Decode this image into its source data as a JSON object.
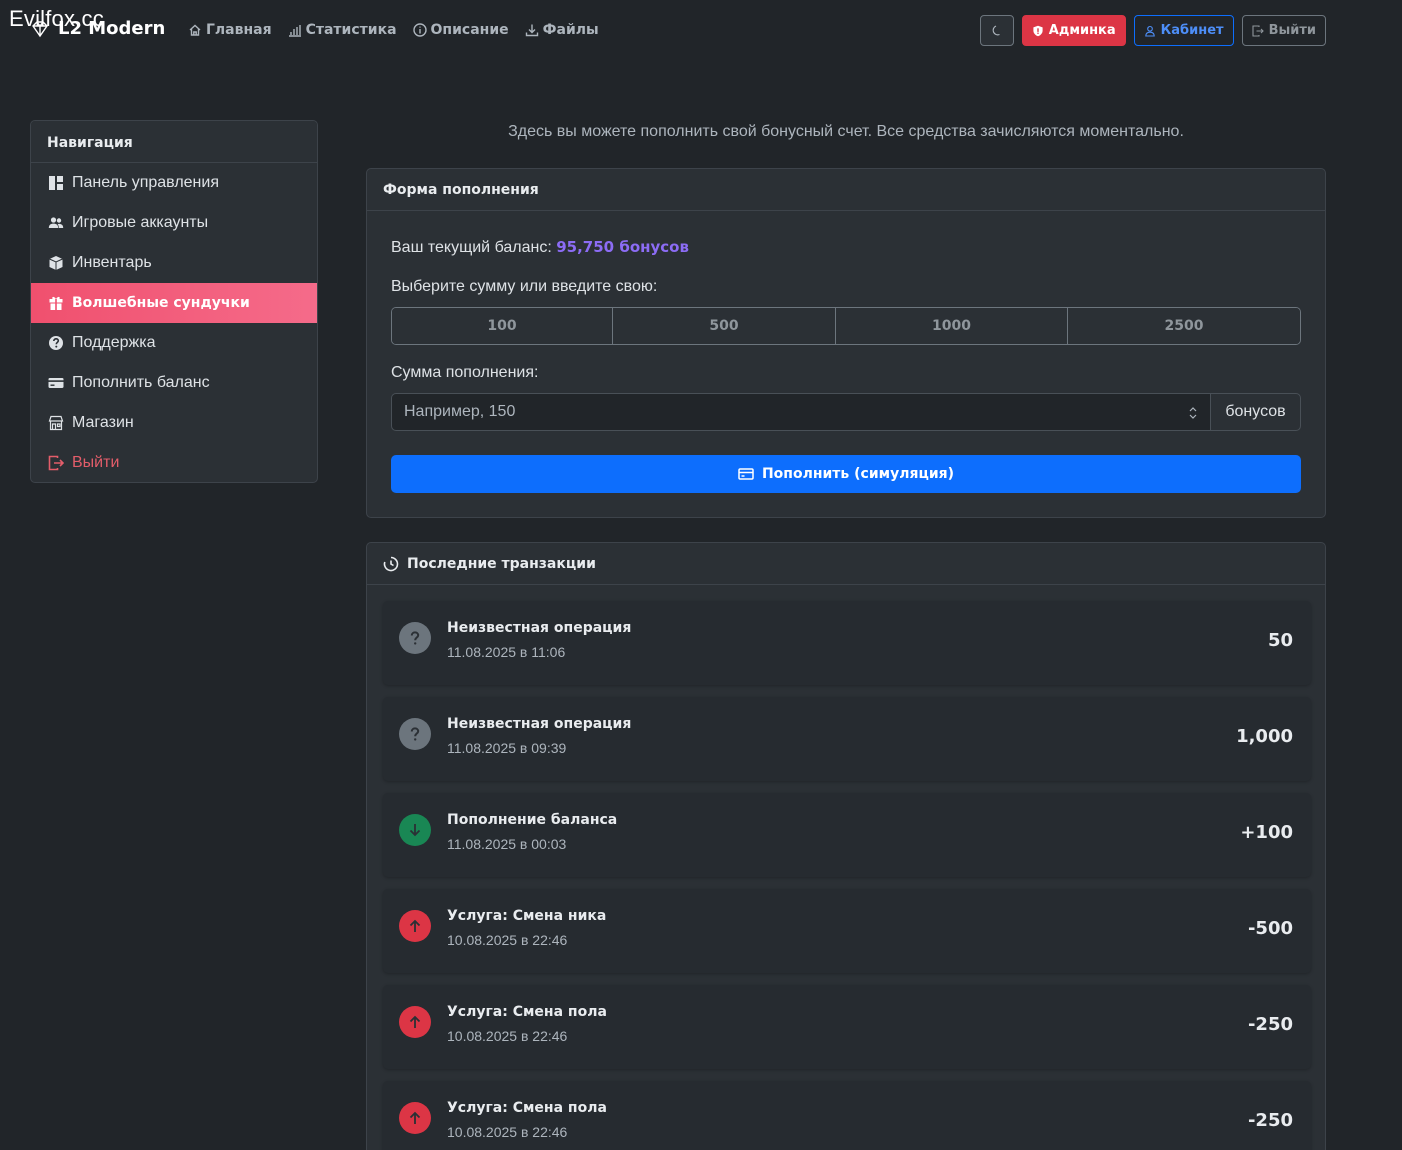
{
  "watermark": "Evilfox.cc",
  "header": {
    "brand": "L2 Modern",
    "nav": [
      {
        "label": "Главная",
        "icon": "home-icon"
      },
      {
        "label": "Статистика",
        "icon": "bar-chart-icon"
      },
      {
        "label": "Описание",
        "icon": "info-icon"
      },
      {
        "label": "Файлы",
        "icon": "download-icon"
      }
    ],
    "buttons": {
      "theme_icon": "moon-icon",
      "admin": "Админка",
      "cabinet": "Кабинет",
      "logout": "Выйти"
    }
  },
  "sidebar": {
    "title": "Навигация",
    "items": [
      {
        "label": "Панель управления",
        "icon": "dashboard-icon"
      },
      {
        "label": "Игровые аккаунты",
        "icon": "users-icon"
      },
      {
        "label": "Инвентарь",
        "icon": "box-icon"
      },
      {
        "label": "Волшебные сундучки",
        "icon": "gift-icon",
        "active": true
      },
      {
        "label": "Поддержка",
        "icon": "question-icon"
      },
      {
        "label": "Пополнить баланс",
        "icon": "card-icon"
      },
      {
        "label": "Магазин",
        "icon": "shop-icon"
      },
      {
        "label": "Выйти",
        "icon": "logout-icon"
      }
    ]
  },
  "intro": "Здесь вы можете пополнить свой бонусный счет. Все средства зачисляются моментально.",
  "form": {
    "title": "Форма пополнения",
    "balance_label": "Ваш текущий баланс:",
    "balance_value": "95,750 бонусов",
    "choose_label": "Выберите сумму или введите свою:",
    "amounts": [
      "100",
      "500",
      "1000",
      "2500"
    ],
    "sum_label": "Сумма пополнения:",
    "sum_placeholder": "Например, 150",
    "sum_value": "",
    "sum_addon": "бонусов",
    "submit": "Пополнить (симуляция)"
  },
  "transactions": {
    "title": "Последние транзакции",
    "items": [
      {
        "type": "unknown",
        "title": "Неизвестная операция",
        "date": "11.08.2025 в 11:06",
        "amount": "50"
      },
      {
        "type": "unknown",
        "title": "Неизвестная операция",
        "date": "11.08.2025 в 09:39",
        "amount": "1,000"
      },
      {
        "type": "deposit",
        "title": "Пополнение баланса",
        "date": "11.08.2025 в 00:03",
        "amount": "+100"
      },
      {
        "type": "spend",
        "title": "Услуга: Смена ника",
        "date": "10.08.2025 в 22:46",
        "amount": "-500"
      },
      {
        "type": "spend",
        "title": "Услуга: Смена пола",
        "date": "10.08.2025 в 22:46",
        "amount": "-250"
      },
      {
        "type": "spend",
        "title": "Услуга: Смена пола",
        "date": "10.08.2025 в 22:46",
        "amount": "-250"
      }
    ]
  },
  "colors": {
    "background": "#212529",
    "card": "#2b3035",
    "accent_active": "#f0506e",
    "primary": "#0d6efd",
    "danger": "#dc3545",
    "success": "#198754",
    "balance": "#8c6cf5"
  }
}
